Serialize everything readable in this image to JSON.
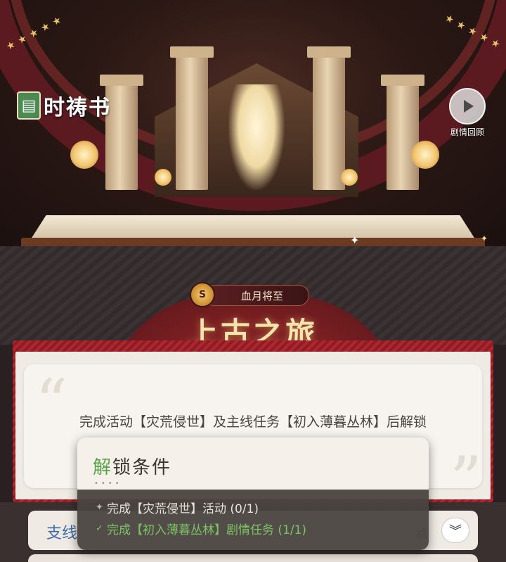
{
  "hero": {
    "title": "时祷书",
    "title_icon": "book-icon",
    "replay_label": "剧情回顾",
    "replay_icon": "replay-icon"
  },
  "chapter": {
    "subtitle": "血月将至",
    "title": "上古之旅",
    "coin_icon": "coin-icon"
  },
  "card": {
    "description": "完成活动【灾荒侵世】及主线任务【初入薄暮丛林】后解锁"
  },
  "branch_row": {
    "label": "支线",
    "suffix": "点",
    "chevron_icon": "double-chevron-down-icon"
  },
  "tooltip": {
    "title_accent": "解",
    "title_rest": "锁条件",
    "conditions": [
      {
        "mark": "✦",
        "text": "完成【灾荒侵世】活动 (0/1)",
        "status": "pending"
      },
      {
        "mark": "✓",
        "text": "完成【初入薄暮丛林】剧情任务 (1/1)",
        "status": "done"
      }
    ]
  },
  "colors": {
    "done": "#7cc265",
    "accent_red": "#b0262e",
    "title_gold": "#f7e3b2"
  }
}
